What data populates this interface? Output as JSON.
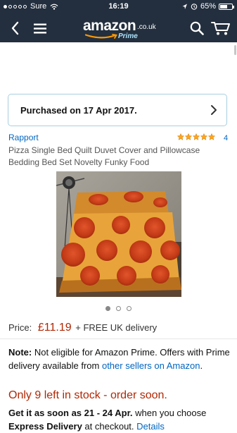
{
  "status_bar": {
    "carrier": "Sure",
    "time": "16:19",
    "battery": "65%",
    "battery_level": 0.65
  },
  "header": {
    "logo_text": "amazon",
    "logo_tld": ".co.uk",
    "logo_prime": "Prime"
  },
  "purchased": {
    "text": "Purchased on 17 Apr 2017."
  },
  "product": {
    "brand": "Rapport",
    "rating_count": "4",
    "stars_filled": 5,
    "title": "Pizza Single Bed Quilt Duvet Cover and Pillowcase Bedding Bed Set Novelty Funky Food",
    "image_count": 3,
    "active_image": 1
  },
  "price": {
    "label": "Price:",
    "amount": "£11.19",
    "delivery": "+ FREE UK delivery"
  },
  "note": {
    "label": "Note:",
    "text": "Not eligible for Amazon Prime. Offers with Prime delivery available from",
    "link": "other sellers on Amazon",
    "end": "."
  },
  "stock": {
    "text": "Only 9 left in stock - order soon."
  },
  "delivery": {
    "prefix": "Get it as soon as 21 - 24 Apr.",
    "suffix": "when you choose",
    "line2_bold": "Express Delivery",
    "line2_text": "at checkout.",
    "line2_link": "Details"
  }
}
